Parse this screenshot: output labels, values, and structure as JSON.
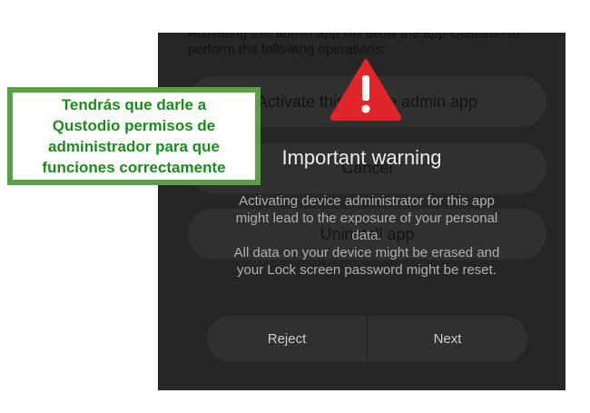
{
  "background_screen": {
    "intro_text": "Activating this admin app will allow the app Qustodio to\nperform the following operations:",
    "activate_button": "Activate this device admin app",
    "cancel_button": "Cancel",
    "uninstall_button": "Uninstall app"
  },
  "dialog": {
    "icon": "warning-triangle-icon",
    "title": "Important warning",
    "message": "Activating device administrator for this app\nmight lead to the exposure of your personal\ndata.\nAll data on your device might be erased and\nyour Lock screen password might be reset.",
    "reject_label": "Reject",
    "next_label": "Next"
  },
  "callout": {
    "text": "Tendrás que darle a\nQustodio permisos de\nadministrador para que\nfunciones correctamente"
  },
  "colors": {
    "warning_red": "#e0262b",
    "callout_green": "#5aa045",
    "callout_text_green": "#1f8a1f",
    "dialog_background": "#262626"
  }
}
